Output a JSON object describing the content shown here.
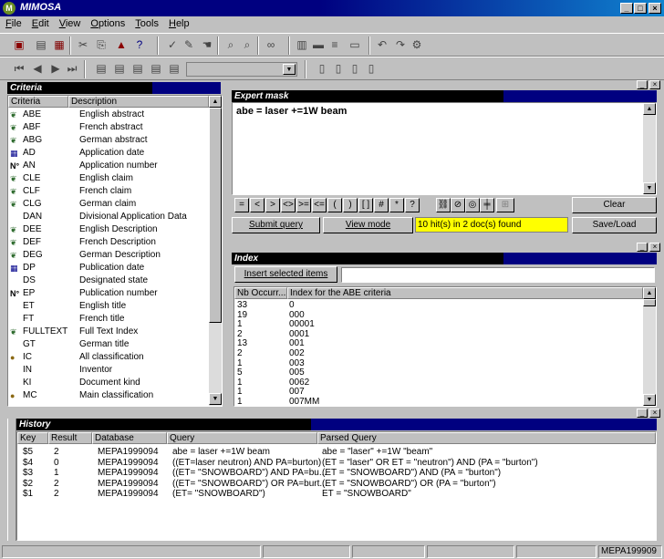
{
  "window": {
    "title": "MIMOSA"
  },
  "menu": [
    "File",
    "Edit",
    "View",
    "Options",
    "Tools",
    "Help"
  ],
  "criteria": {
    "title": "Criteria",
    "col_code": "Criteria",
    "col_desc": "Description",
    "rows": [
      {
        "code": "ABE",
        "desc": "English abstract",
        "icon": "tree-icon"
      },
      {
        "code": "ABF",
        "desc": "French abstract",
        "icon": "tree-icon"
      },
      {
        "code": "ABG",
        "desc": "German abstract",
        "icon": "tree-icon"
      },
      {
        "code": "AD",
        "desc": "Application date",
        "icon": "calendar-icon"
      },
      {
        "code": "AN",
        "desc": "Application number",
        "icon": "number-icon"
      },
      {
        "code": "CLE",
        "desc": "English claim",
        "icon": "tree-icon"
      },
      {
        "code": "CLF",
        "desc": "French claim",
        "icon": "tree-icon"
      },
      {
        "code": "CLG",
        "desc": "German claim",
        "icon": "tree-icon"
      },
      {
        "code": "DAN",
        "desc": "Divisional Application Data",
        "icon": ""
      },
      {
        "code": "DEE",
        "desc": "English Description",
        "icon": "tree-icon"
      },
      {
        "code": "DEF",
        "desc": "French Description",
        "icon": "tree-icon"
      },
      {
        "code": "DEG",
        "desc": "German Description",
        "icon": "tree-icon"
      },
      {
        "code": "DP",
        "desc": "Publication date",
        "icon": "calendar-icon"
      },
      {
        "code": "DS",
        "desc": "Designated state",
        "icon": ""
      },
      {
        "code": "EP",
        "desc": "Publication number",
        "icon": "number-icon"
      },
      {
        "code": "ET",
        "desc": "English title",
        "icon": ""
      },
      {
        "code": "FT",
        "desc": "French title",
        "icon": ""
      },
      {
        "code": "FULLTEXT",
        "desc": "Full Text Index",
        "icon": "tree-icon"
      },
      {
        "code": "GT",
        "desc": "German title",
        "icon": ""
      },
      {
        "code": "IC",
        "desc": "All classification",
        "icon": "globe-icon"
      },
      {
        "code": "IN",
        "desc": "Inventor",
        "icon": ""
      },
      {
        "code": "KI",
        "desc": "Document kind",
        "icon": ""
      },
      {
        "code": "MC",
        "desc": "Main classification",
        "icon": "globe-icon"
      }
    ]
  },
  "expert": {
    "title": "Expert mask",
    "query": "abe = laser  +=1W beam",
    "operators": [
      "=",
      "<",
      ">",
      "<>",
      ">=",
      "<=",
      "(",
      ")",
      "[ ]",
      "#",
      "*",
      "?"
    ],
    "clear_label": "Clear",
    "submit_label": "Submit query",
    "view_label": "View mode",
    "hits": "10 hit(s) in 2 doc(s) found",
    "saveload_label": "Save/Load"
  },
  "index": {
    "title": "Index",
    "insert_label": "Insert selected items",
    "input_value": "",
    "col_count": "Nb Occurr...",
    "col_index": "Index for the ABE criteria",
    "rows": [
      {
        "n": "33",
        "v": "0"
      },
      {
        "n": "19",
        "v": "000"
      },
      {
        "n": "1",
        "v": "00001"
      },
      {
        "n": "2",
        "v": "0001"
      },
      {
        "n": "13",
        "v": "001"
      },
      {
        "n": "2",
        "v": "002"
      },
      {
        "n": "1",
        "v": "003"
      },
      {
        "n": "5",
        "v": "005"
      },
      {
        "n": "1",
        "v": "0062"
      },
      {
        "n": "1",
        "v": "007"
      },
      {
        "n": "1",
        "v": "007MM"
      }
    ]
  },
  "history": {
    "title": "History",
    "cols": [
      "Key",
      "Result",
      "Database",
      "Query",
      "Parsed Query"
    ],
    "rows": [
      {
        "key": "$5",
        "result": "2",
        "db": "MEPA1999094",
        "query": "abe = laser  +=1W beam",
        "parsed": "abe = \"laser\" +=1W \"beam\""
      },
      {
        "key": "$4",
        "result": "0",
        "db": "MEPA1999094",
        "query": "((ET=laser neutron) AND PA=burton)",
        "parsed": "(ET = \"laser\" OR ET = \"neutron\") AND (PA = \"burton\")"
      },
      {
        "key": "$3",
        "result": "1",
        "db": "MEPA1999094",
        "query": "((ET= \"SNOWBOARD\") AND PA=bu...",
        "parsed": "(ET = \"SNOWBOARD\") AND (PA = \"burton\")"
      },
      {
        "key": "$2",
        "result": "2",
        "db": "MEPA1999094",
        "query": "((ET= \"SNOWBOARD\") OR PA=burt...",
        "parsed": "(ET = \"SNOWBOARD\") OR (PA = \"burton\")"
      },
      {
        "key": "$1",
        "result": "2",
        "db": "MEPA1999094",
        "query": "(ET= \"SNOWBOARD\")",
        "parsed": "ET = \"SNOWBOARD\""
      }
    ]
  },
  "status": {
    "db": "MEPA199909"
  },
  "colors": {
    "titlebar": "#000080",
    "hits_bg": "#ffff00",
    "face": "#c0c0c0"
  }
}
